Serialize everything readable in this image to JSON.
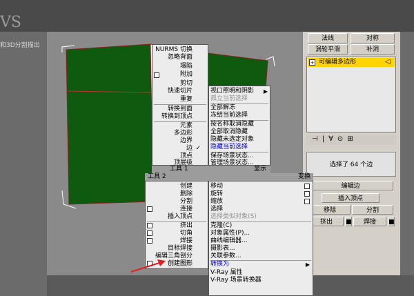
{
  "background": {
    "letters": "VS",
    "caption": "和3D分割描出"
  },
  "right_panel": {
    "row1": [
      "法线",
      "对称"
    ],
    "row2": [
      "涡轮平滑",
      "补洞"
    ],
    "modifier": "可编辑多边形",
    "selection_info": "选择了 64 个边",
    "edit_edge": "编辑边",
    "insert_vertex": "插入顶点",
    "remove": "移除",
    "split": "分割",
    "extrude": "挤出",
    "weld": "焊接"
  },
  "quad_left_top": [
    "NURMS 切换",
    "忽略背面",
    "塌陷",
    "附加",
    "剪切",
    "快速切片",
    "重复",
    "转换到面",
    "转换到顶点",
    "元素",
    "多边形",
    "边界",
    "边",
    "顶点",
    "顶层级"
  ],
  "quad_right_top": [
    "视口照明和阴影",
    "孤立当前选择",
    "全部解冻",
    "冻结当前选择",
    "按名称取消隐藏",
    "全部取消隐藏",
    "隐藏未选定对象",
    "隐藏当前选择",
    "保存场景状态...",
    "管理场景状态..."
  ],
  "quad_headers": {
    "tools1": "工具 1",
    "display": "显示",
    "tools2": "工具 2",
    "transform": "变换"
  },
  "quad_left_bottom": [
    "创建",
    "删除",
    "分割",
    "连接",
    "插入顶点",
    "挤出",
    "切角",
    "焊接",
    "目标焊接",
    "编辑三角剖分",
    "创建图形"
  ],
  "quad_right_bottom": [
    "移动",
    "旋转",
    "缩放",
    "选择",
    "选择类似对象(S)",
    "克隆(C)",
    "对象属性(P)...",
    "曲线编辑器...",
    "摄影表...",
    "关联参数...",
    "转换为",
    "V-Ray 属性",
    "V-Ray 场景转换器"
  ],
  "colors": {
    "mesh_green": "#0e5a0e",
    "modifier_yellow": "#ffd400",
    "arrow_red": "#e02020"
  }
}
